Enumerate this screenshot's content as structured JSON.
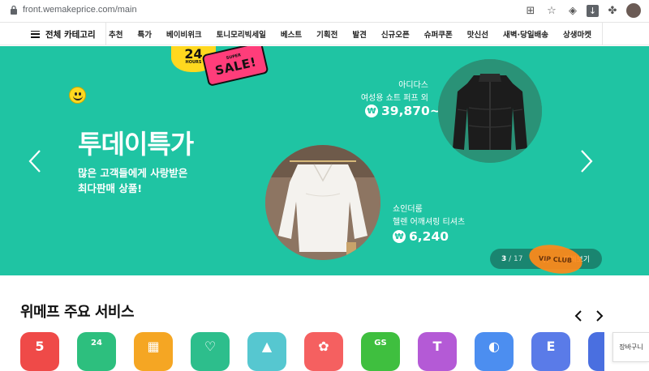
{
  "browser": {
    "url": "front.wemakeprice.com/main",
    "icons": [
      "translate-icon",
      "star-icon",
      "extension-icon",
      "download-icon",
      "puzzle-icon",
      "profile-avatar"
    ]
  },
  "nav": {
    "category_label": "전체 카테고리",
    "menu": [
      "추천",
      "특가",
      "베이비위크",
      "토니모리빅세일",
      "베스트",
      "기획전",
      "발견",
      "신규오픈",
      "슈퍼쿠폰",
      "맛신선",
      "새벽·당일배송",
      "상생마켓"
    ]
  },
  "hero": {
    "background": "#1fc4a3",
    "badge_number": "24",
    "badge_text": "HOURS",
    "sale_super": "SUPER",
    "sale_text": "SALE!",
    "title": "투데이특가",
    "subtitle_line1": "많은 고객들에게 사랑받은",
    "subtitle_line2": "최다판매 상품!",
    "product1": {
      "brand": "아디다스",
      "name": "여성용 쇼트 퍼프 외",
      "price": "39,870~"
    },
    "product2": {
      "brand": "쇼인더룸",
      "name": "헬렌 어깨셔링 티셔츠",
      "price": "6,240"
    },
    "won_symbol": "₩",
    "pager": {
      "current": "3",
      "total": "17",
      "separator": " / ",
      "view_all": "전체보기"
    },
    "vip_sticker": "VIP CLUB"
  },
  "services": {
    "title": "위메프 주요 서비스",
    "icons": [
      {
        "name": "special-price",
        "glyph": "5"
      },
      {
        "name": "24-hour",
        "glyph": "24"
      },
      {
        "name": "building",
        "glyph": "▦"
      },
      {
        "name": "heart",
        "glyph": "♡"
      },
      {
        "name": "landscape",
        "glyph": "▲"
      },
      {
        "name": "gift",
        "glyph": "✿"
      },
      {
        "name": "gs-fresh",
        "glyph": "GS"
      },
      {
        "name": "t-service",
        "glyph": "T"
      },
      {
        "name": "globe",
        "glyph": "◐"
      },
      {
        "name": "e-coupon",
        "glyph": "E"
      },
      {
        "name": "more",
        "glyph": ""
      }
    ]
  },
  "cart_label": "장바구니"
}
